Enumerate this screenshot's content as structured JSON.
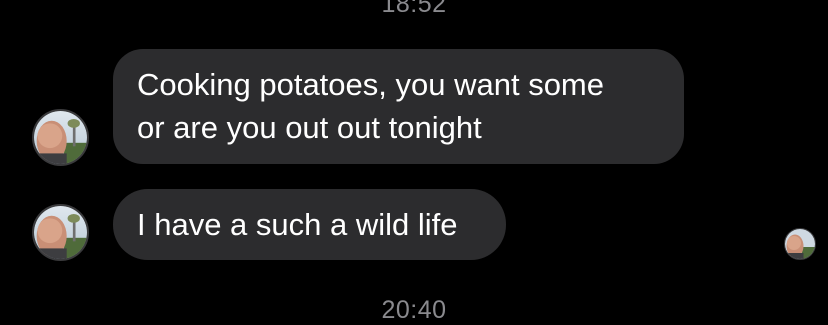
{
  "chat": {
    "timestamp_top": "18:52",
    "timestamp_bottom": "20:40",
    "messages": [
      {
        "lines": [
          "Cooking potatoes, you want some",
          "or are you out out tonight"
        ]
      },
      {
        "lines": [
          "I have a such a wild life"
        ]
      }
    ]
  },
  "colors": {
    "background": "#000000",
    "bubble": "#2c2c2e",
    "text": "#ffffff",
    "timestamp": "#8a8a8e"
  },
  "icons": {
    "sender_avatar": "profile-photo",
    "read_receipt": "profile-photo-small"
  }
}
